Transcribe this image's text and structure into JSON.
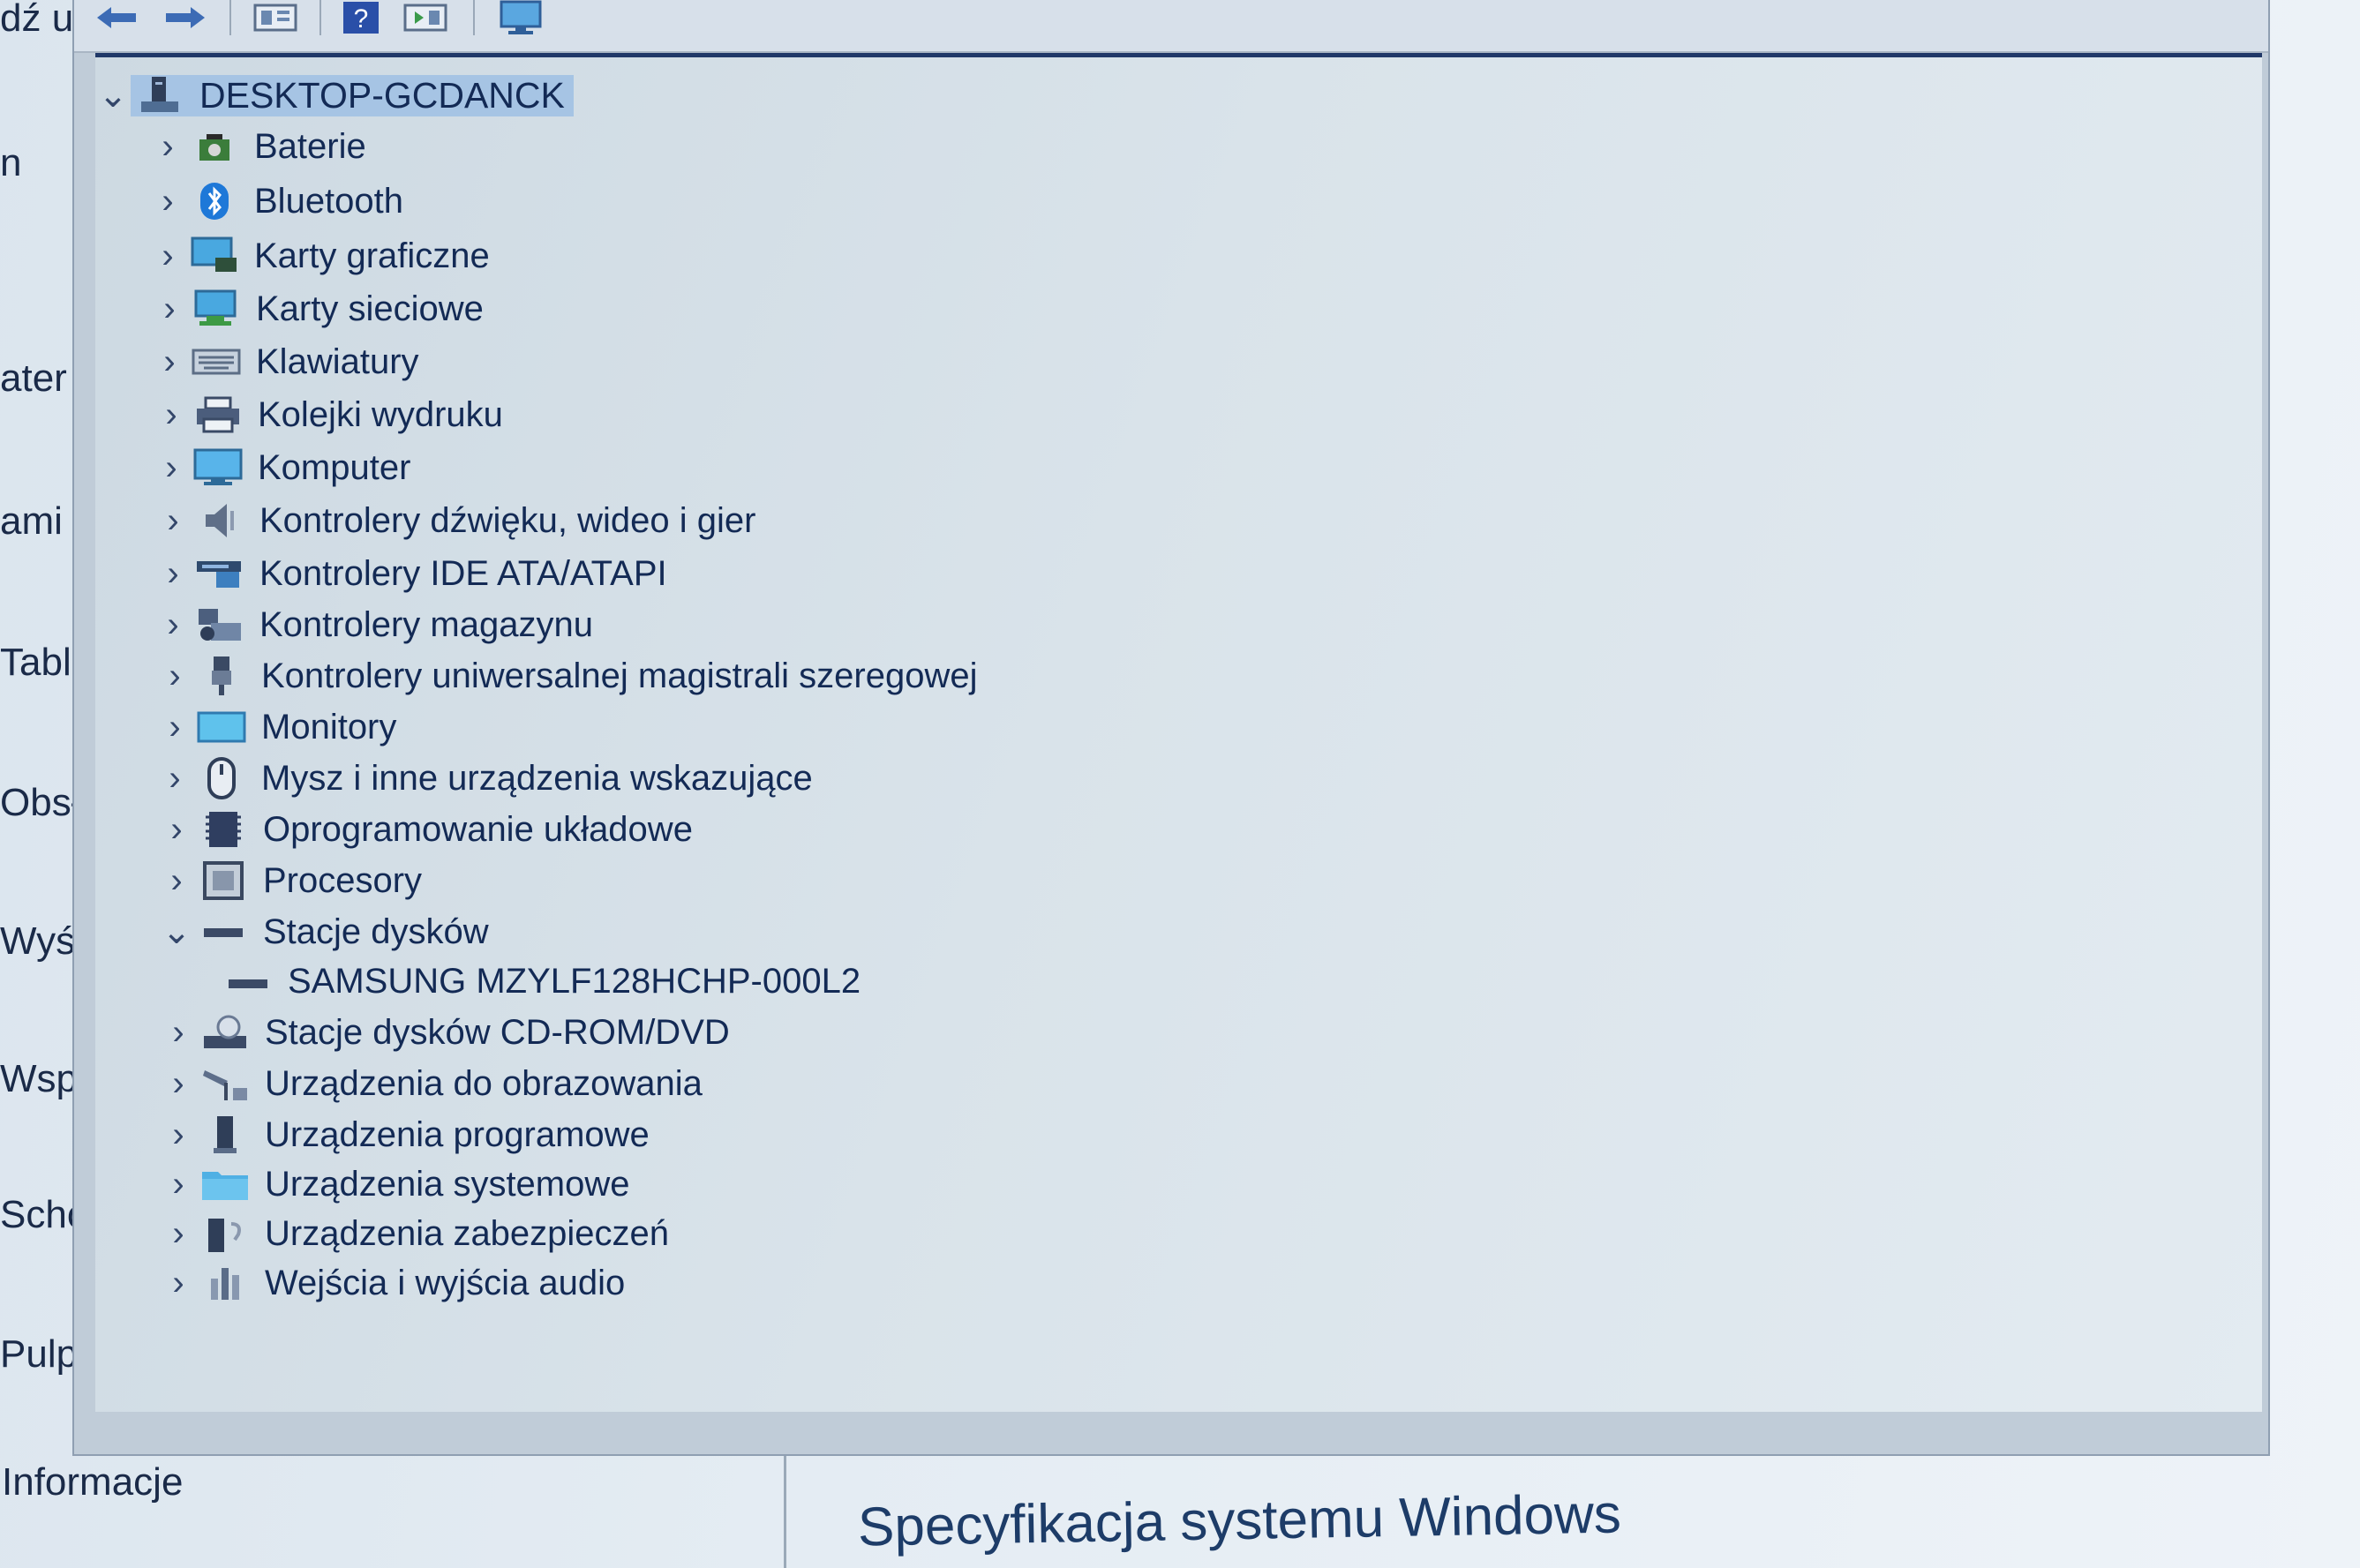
{
  "background": {
    "sidebar_fragments": [
      "dź u",
      "n",
      "ater",
      "ami",
      "Table",
      "Obsł",
      "Wyśv",
      "Wspó",
      "Scho",
      "Pulpi"
    ],
    "info_label": "Informacje",
    "spec_title": "Specyfikacja systemu Windows"
  },
  "toolbar": {
    "buttons": [
      "back-arrow-icon",
      "forward-arrow-icon",
      "properties-icon",
      "help-icon",
      "view-icon",
      "monitor-icon"
    ]
  },
  "tree": {
    "root": {
      "label": "DESKTOP-GCDANCK",
      "icon": "computer-tower-icon",
      "expanded": true
    },
    "items": [
      {
        "label": "Baterie",
        "icon": "battery-icon"
      },
      {
        "label": "Bluetooth",
        "icon": "bluetooth-icon"
      },
      {
        "label": "Karty graficzne",
        "icon": "display-adapter-icon"
      },
      {
        "label": "Karty sieciowe",
        "icon": "network-adapter-icon"
      },
      {
        "label": "Klawiatury",
        "icon": "keyboard-icon"
      },
      {
        "label": "Kolejki wydruku",
        "icon": "printer-icon"
      },
      {
        "label": "Komputer",
        "icon": "monitor-icon"
      },
      {
        "label": "Kontrolery dźwięku, wideo i gier",
        "icon": "speaker-icon"
      },
      {
        "label": "Kontrolery IDE ATA/ATAPI",
        "icon": "ide-controller-icon"
      },
      {
        "label": "Kontrolery magazynu",
        "icon": "storage-controller-icon"
      },
      {
        "label": "Kontrolery uniwersalnej magistrali szeregowej",
        "icon": "usb-icon"
      },
      {
        "label": "Monitory",
        "icon": "monitor-screen-icon"
      },
      {
        "label": "Mysz i inne urządzenia wskazujące",
        "icon": "mouse-icon"
      },
      {
        "label": "Oprogramowanie układowe",
        "icon": "firmware-chip-icon"
      },
      {
        "label": "Procesory",
        "icon": "processor-icon"
      },
      {
        "label": "Stacje dysków",
        "icon": "disk-drive-icon",
        "expanded": true
      },
      {
        "label": "SAMSUNG MZYLF128HCHP-000L2",
        "icon": "disk-drive-icon",
        "child": true
      },
      {
        "label": "Stacje dysków CD-ROM/DVD",
        "icon": "cdrom-icon"
      },
      {
        "label": "Urządzenia do obrazowania",
        "icon": "camera-icon"
      },
      {
        "label": "Urządzenia programowe",
        "icon": "software-device-icon"
      },
      {
        "label": "Urządzenia systemowe",
        "icon": "system-folder-icon"
      },
      {
        "label": "Urządzenia zabezpieczeń",
        "icon": "security-device-icon"
      },
      {
        "label": "Wejścia i wyjścia audio",
        "icon": "audio-io-icon"
      }
    ]
  }
}
